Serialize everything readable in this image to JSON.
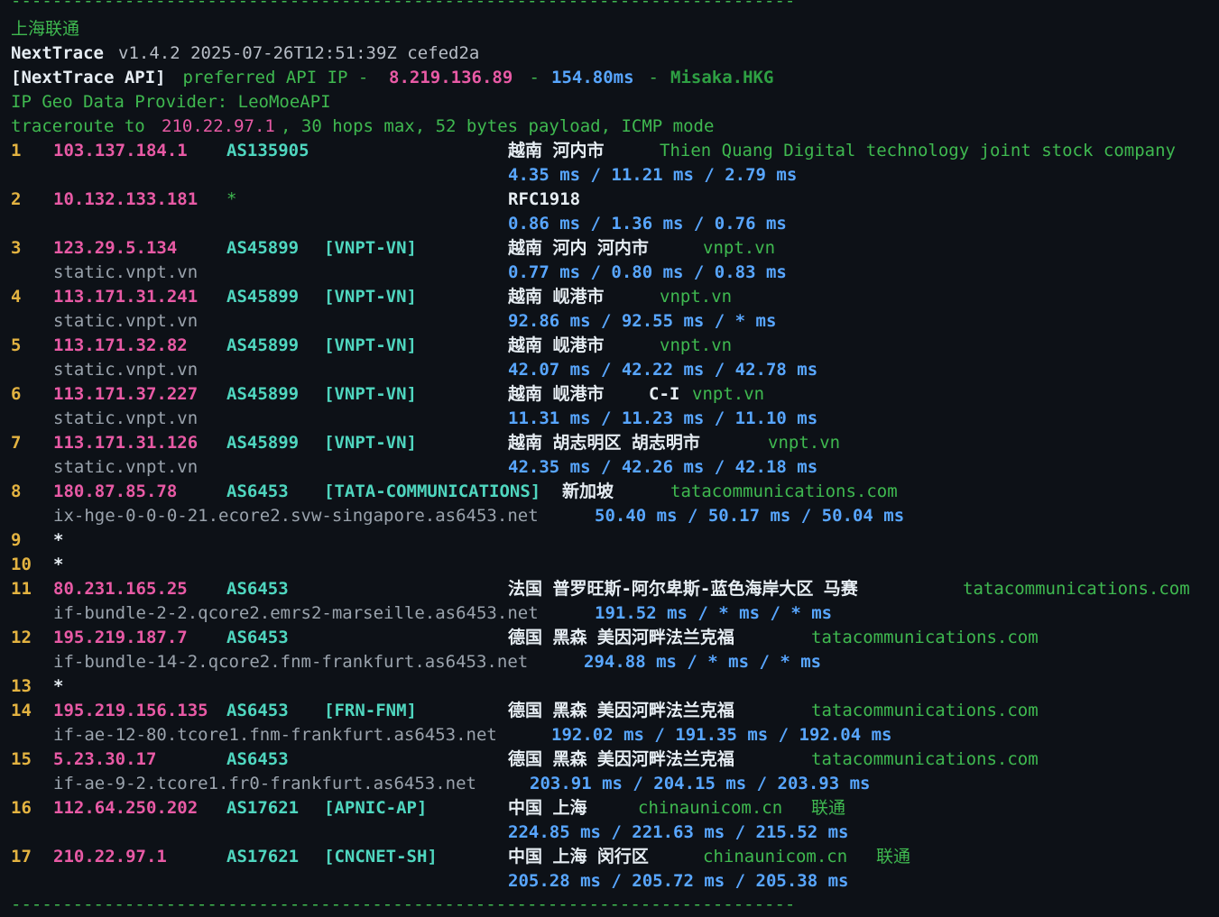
{
  "rule": "----------------------------------------------------------------------------",
  "header": {
    "title": "上海联通",
    "app": "NextTrace",
    "version": "v1.4.2 2025-07-26T12:51:39Z cefed2a",
    "api_tag": "[NextTrace API]",
    "api_pref": " preferred API IP - ",
    "api_ip": "8.219.136.89",
    "dash1": " - ",
    "api_latency": "154.80ms",
    "dash2": " - ",
    "api_node": "Misaka.HKG",
    "geo_provider": "IP Geo Data Provider: LeoMoeAPI",
    "trace_prefix": "traceroute to ",
    "trace_target": "210.22.97.1",
    "trace_suffix": ", 30 hops max, 52 bytes payload, ICMP mode"
  },
  "hops": [
    {
      "num": "1",
      "ip": "103.137.184.1",
      "asn": "AS135905",
      "tag": "",
      "geo": "越南 河内市",
      "geox": 563,
      "org": "Thien Quang Digital technology joint stock company",
      "orgx": 731,
      "host": "",
      "lat": [
        "4.35",
        "11.21",
        "2.79"
      ],
      "latx": 563
    },
    {
      "num": "2",
      "ip": "10.132.133.181",
      "asn": "*",
      "tag": "",
      "geo": "RFC1918",
      "geox": 563,
      "geo_style": "white bold",
      "org": "",
      "orgx": 0,
      "host": "",
      "lat": [
        "0.86",
        "1.36",
        "0.76"
      ],
      "latx": 563
    },
    {
      "num": "3",
      "ip": "123.29.5.134",
      "asn": "AS45899",
      "tag": "[VNPT-VN]",
      "geo": "越南 河内 河内市",
      "geox": 563,
      "org": "vnpt.vn",
      "orgx": 779,
      "host": "static.vnpt.vn",
      "lat": [
        "0.77",
        "0.80",
        "0.83"
      ],
      "latx": 563
    },
    {
      "num": "4",
      "ip": "113.171.31.241",
      "asn": "AS45899",
      "tag": "[VNPT-VN]",
      "geo": "越南 岘港市",
      "geox": 563,
      "org": "vnpt.vn",
      "orgx": 731,
      "host": "static.vnpt.vn",
      "lat": [
        "92.86",
        "92.55",
        "*"
      ],
      "latx": 563
    },
    {
      "num": "5",
      "ip": "113.171.32.82",
      "asn": "AS45899",
      "tag": "[VNPT-VN]",
      "geo": "越南 岘港市",
      "geox": 563,
      "org": "vnpt.vn",
      "orgx": 731,
      "host": "static.vnpt.vn",
      "lat": [
        "42.07",
        "42.22",
        "42.78"
      ],
      "latx": 563
    },
    {
      "num": "6",
      "ip": "113.171.37.227",
      "asn": "AS45899",
      "tag": "[VNPT-VN]",
      "geo": "越南 岘港市",
      "geox": 563,
      "geo2": "C-I",
      "geo2x": 719,
      "org": "vnpt.vn",
      "orgx": 767,
      "host": "static.vnpt.vn",
      "lat": [
        "11.31",
        "11.23",
        "11.10"
      ],
      "latx": 563
    },
    {
      "num": "7",
      "ip": "113.171.31.126",
      "asn": "AS45899",
      "tag": "[VNPT-VN]",
      "geo": "越南 胡志明区 胡志明市",
      "geox": 563,
      "org": "vnpt.vn",
      "orgx": 851,
      "host": "static.vnpt.vn",
      "lat": [
        "42.35",
        "42.26",
        "42.18"
      ],
      "latx": 563
    },
    {
      "num": "8",
      "ip": "180.87.85.78",
      "asn": "AS6453",
      "tag": "[TATA-COMMUNICATIONS]",
      "geo": "新加坡",
      "geox": 623,
      "org": "tatacommunications.com",
      "orgx": 743,
      "host": "ix-hge-0-0-0-21.ecore2.svw-singapore.as6453.net",
      "lat": [
        "50.40",
        "50.17",
        "50.04"
      ],
      "latx": 659
    },
    {
      "num": "9",
      "star": true
    },
    {
      "num": "10",
      "star": true
    },
    {
      "num": "11",
      "ip": "80.231.165.25",
      "asn": "AS6453",
      "tag": "",
      "geo": "法国 普罗旺斯-阿尔卑斯-蓝色海岸大区 马赛",
      "geox": 563,
      "org": "tatacommunications.com",
      "orgx": 1067,
      "host": "if-bundle-2-2.qcore2.emrs2-marseille.as6453.net",
      "lat": [
        "191.52",
        "*",
        "*"
      ],
      "latx": 659
    },
    {
      "num": "12",
      "ip": "195.219.187.7",
      "asn": "AS6453",
      "tag": "",
      "geo": "德国 黑森 美因河畔法兰克福",
      "geox": 563,
      "org": "tatacommunications.com",
      "orgx": 899,
      "host": "if-bundle-14-2.qcore2.fnm-frankfurt.as6453.net",
      "lat": [
        "294.88",
        "*",
        "*"
      ],
      "latx": 647
    },
    {
      "num": "13",
      "star": true
    },
    {
      "num": "14",
      "ip": "195.219.156.135",
      "asn": "AS6453",
      "tag": "[FRN-FNM]",
      "geo": "德国 黑森 美因河畔法兰克福",
      "geox": 563,
      "org": "tatacommunications.com",
      "orgx": 899,
      "host": "if-ae-12-80.tcore1.fnm-frankfurt.as6453.net",
      "lat": [
        "192.02",
        "191.35",
        "192.04"
      ],
      "latx": 611
    },
    {
      "num": "15",
      "ip": "5.23.30.17",
      "asn": "AS6453",
      "tag": "",
      "geo": "德国 黑森 美因河畔法兰克福",
      "geox": 563,
      "org": "tatacommunications.com",
      "orgx": 899,
      "host": "if-ae-9-2.tcore1.fr0-frankfurt.as6453.net",
      "lat": [
        "203.91",
        "204.15",
        "203.93"
      ],
      "latx": 587
    },
    {
      "num": "16",
      "ip": "112.64.250.202",
      "asn": "AS17621",
      "tag": "[APNIC-AP]",
      "geo": "中国 上海",
      "geox": 563,
      "org": "chinaunicom.cn",
      "orgx": 707,
      "isp": "联通",
      "ispx": 899,
      "host": "",
      "lat": [
        "224.85",
        "221.63",
        "215.52"
      ],
      "latx": 563
    },
    {
      "num": "17",
      "ip": "210.22.97.1",
      "asn": "AS17621",
      "tag": "[CNCNET-SH]",
      "geo": "中国 上海 闵行区",
      "geox": 563,
      "org": "chinaunicom.cn",
      "orgx": 779,
      "isp": "联通",
      "ispx": 971,
      "host": "",
      "lat": [
        "205.28",
        "205.72",
        "205.38"
      ],
      "latx": 563
    }
  ],
  "units": {
    "ms": "ms",
    "sep": "/"
  },
  "colors": {
    "bg": "#0d1117",
    "ip": "#e85aa5",
    "asn": "#4fd6bf",
    "latency": "#58a6ff",
    "org": "#3fb950",
    "hop": "#e3b341"
  }
}
